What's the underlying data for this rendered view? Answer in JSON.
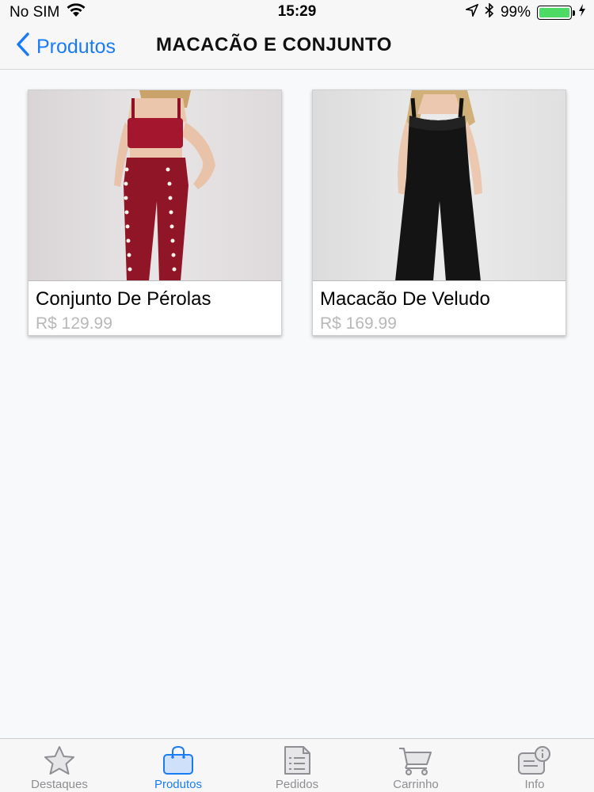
{
  "status_bar": {
    "carrier": "No SIM",
    "time": "15:29",
    "battery_percent": "99%",
    "battery_level": 0.99
  },
  "nav": {
    "back_label": "Produtos",
    "title": "MACACÃO E CONJUNTO"
  },
  "products": [
    {
      "name": "Conjunto De Pérolas",
      "price": "R$ 129.99",
      "image": "red-pearl-set-photo"
    },
    {
      "name": "Macacão De Veludo",
      "price": "R$ 169.99",
      "image": "black-velvet-jumpsuit-photo"
    }
  ],
  "tabs": [
    {
      "label": "Destaques",
      "icon": "star-icon",
      "active": false
    },
    {
      "label": "Produtos",
      "icon": "shopping-bag-icon",
      "active": true
    },
    {
      "label": "Pedidos",
      "icon": "document-list-icon",
      "active": false
    },
    {
      "label": "Carrinho",
      "icon": "cart-icon",
      "active": false
    },
    {
      "label": "Info",
      "icon": "info-icon",
      "active": false
    }
  ],
  "colors": {
    "accent": "#1a7cf5",
    "inactive": "#8e8e93",
    "price": "#b8b8b8",
    "battery": "#4cd964"
  }
}
